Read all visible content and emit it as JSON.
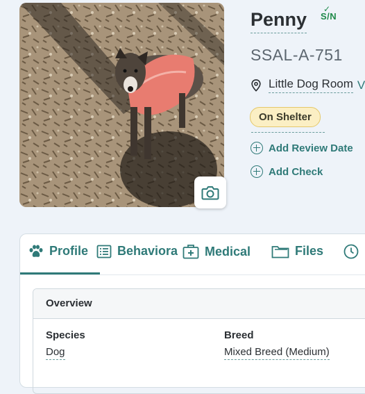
{
  "animal": {
    "name": "Penny",
    "sn_badge": "S/N",
    "shelter_id": "SSAL-A-751",
    "location": "Little Dog Room",
    "location_extra": "V",
    "status": "On Shelter"
  },
  "actions": {
    "add_review_date": "Add Review Date",
    "add_check": "Add Check"
  },
  "tabs": [
    {
      "label": "Profile",
      "icon": "paw-icon"
    },
    {
      "label": "Behaviora",
      "icon": "list-icon"
    },
    {
      "label": "Medical",
      "icon": "medical-kit-icon"
    },
    {
      "label": "Files",
      "icon": "folder-icon"
    },
    {
      "label": "",
      "icon": "clock-icon"
    }
  ],
  "overview": {
    "title": "Overview",
    "species_label": "Species",
    "species_value": "Dog",
    "breed_label": "Breed",
    "breed_value": "Mixed Breed (Medium)"
  },
  "colors": {
    "accent": "#2f7a78",
    "status_bg": "#fbefc4",
    "sn_green": "#1f8a4a",
    "page_bg": "#eef3f9"
  }
}
